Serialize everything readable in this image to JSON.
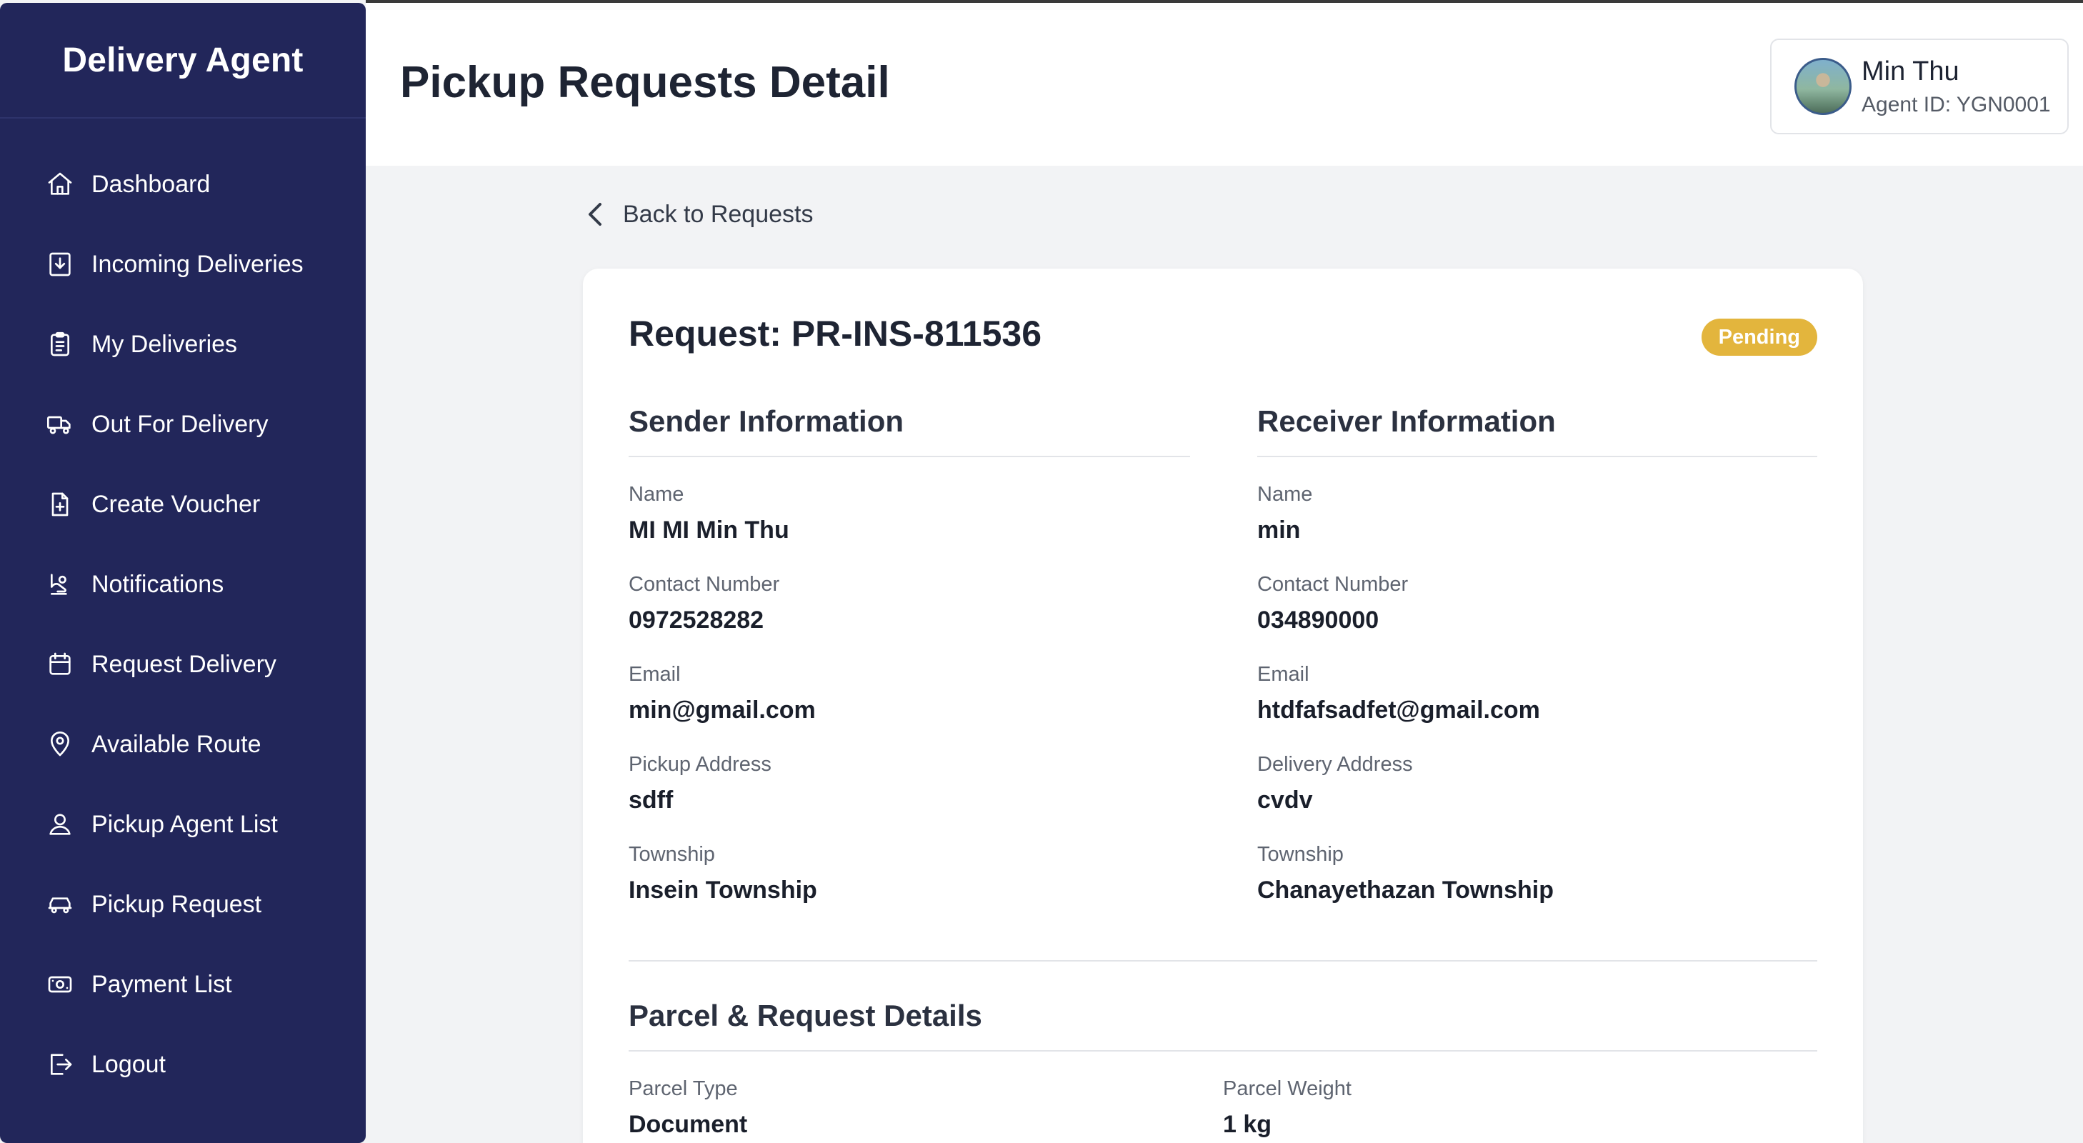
{
  "app": {
    "brand": "Delivery Agent"
  },
  "sidebar": {
    "items": [
      {
        "label": "Dashboard",
        "icon": "home-icon"
      },
      {
        "label": "Incoming Deliveries",
        "icon": "inbox-download-icon"
      },
      {
        "label": "My Deliveries",
        "icon": "clipboard-icon"
      },
      {
        "label": "Out For Delivery",
        "icon": "truck-icon"
      },
      {
        "label": "Create Voucher",
        "icon": "file-plus-icon"
      },
      {
        "label": "Notifications",
        "icon": "bell-hand-icon"
      },
      {
        "label": "Request Delivery",
        "icon": "calendar-icon"
      },
      {
        "label": "Available Route",
        "icon": "map-pin-icon"
      },
      {
        "label": "Pickup Agent List",
        "icon": "user-icon"
      },
      {
        "label": "Pickup Request",
        "icon": "car-icon"
      },
      {
        "label": "Payment List",
        "icon": "banknote-icon"
      },
      {
        "label": "Logout",
        "icon": "logout-icon"
      }
    ]
  },
  "header": {
    "title": "Pickup Requests Detail",
    "profile": {
      "name": "Min Thu",
      "agent_id": "Agent ID: YGN0001"
    }
  },
  "back_link": "Back to Requests",
  "request": {
    "title": "Request: PR-INS-811536",
    "status": "Pending",
    "status_color": "#e3b53d"
  },
  "sender": {
    "section_title": "Sender Information",
    "fields": [
      {
        "label": "Name",
        "value": "MI MI Min Thu"
      },
      {
        "label": "Contact Number",
        "value": "0972528282"
      },
      {
        "label": "Email",
        "value": "min@gmail.com"
      },
      {
        "label": "Pickup Address",
        "value": "sdff"
      },
      {
        "label": "Township",
        "value": "Insein Township"
      }
    ]
  },
  "receiver": {
    "section_title": "Receiver Information",
    "fields": [
      {
        "label": "Name",
        "value": "min"
      },
      {
        "label": "Contact Number",
        "value": "034890000"
      },
      {
        "label": "Email",
        "value": "htdfafsadfet@gmail.com"
      },
      {
        "label": "Delivery Address",
        "value": "cvdv"
      },
      {
        "label": "Township",
        "value": "Chanayethazan Township"
      }
    ]
  },
  "parcel": {
    "section_title": "Parcel & Request Details",
    "fields": [
      {
        "label": "Parcel Type",
        "value": "Document"
      },
      {
        "label": "Parcel Weight",
        "value": "1 kg"
      }
    ]
  },
  "colors": {
    "sidebar_bg": "#22265a",
    "accent_badge": "#e3b53d"
  }
}
